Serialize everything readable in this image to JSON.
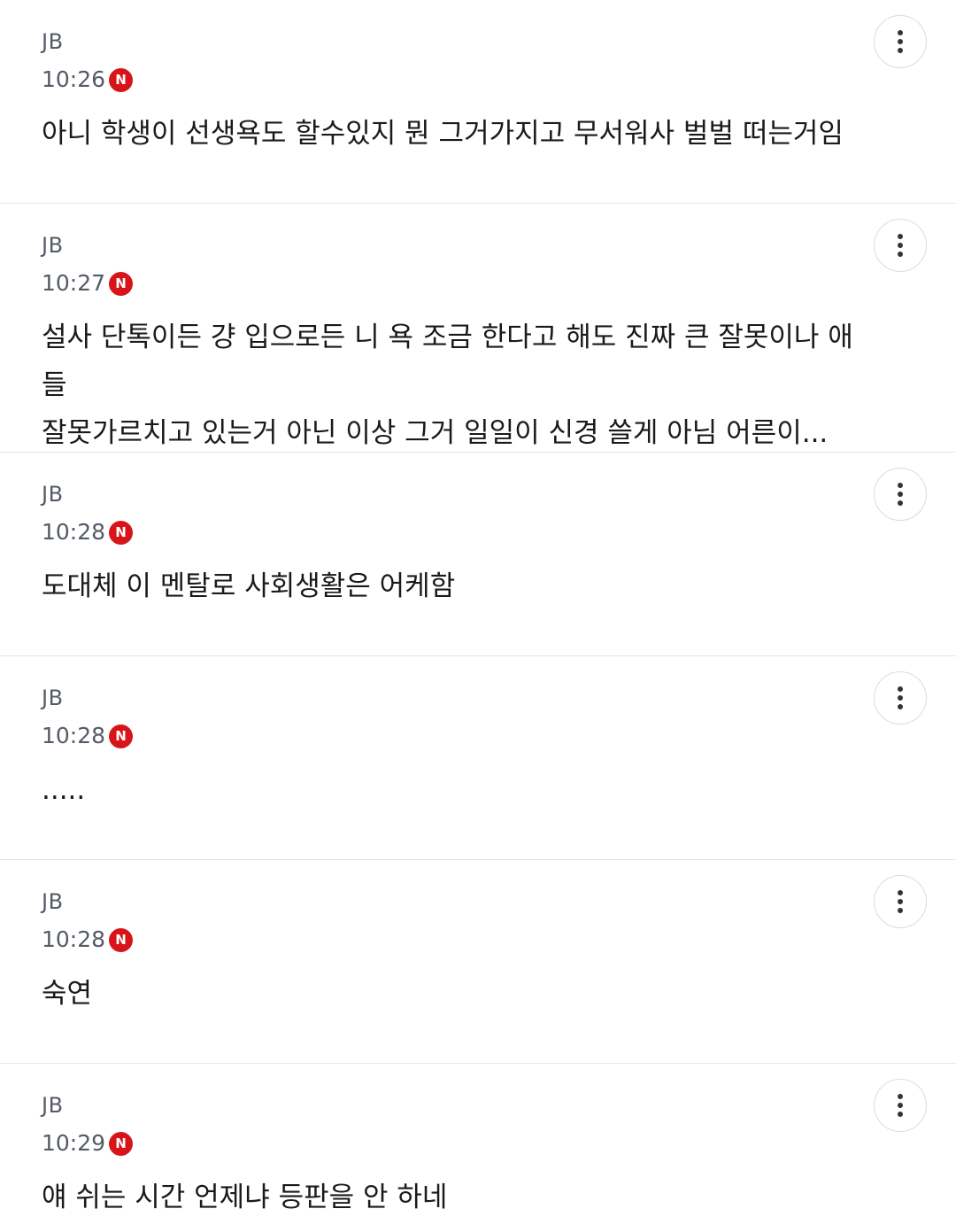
{
  "comments": [
    {
      "author": "JB",
      "time": "10:26",
      "badge": "N",
      "text": "아니 학생이 선생욕도 할수있지 뭔 그거가지고 무서워사 벌벌 떠는거임"
    },
    {
      "author": "JB",
      "time": "10:27",
      "badge": "N",
      "text": "설사 단톡이든 걍 입으로든 니 욕 조금 한다고 해도 진짜 큰 잘못이나 애들\n잘못가르치고 있는거 아닌 이상 그거 일일이 신경 쓸게 아님 어른이..."
    },
    {
      "author": "JB",
      "time": "10:28",
      "badge": "N",
      "text": "도대체 이 멘탈로 사회생활은 어케함"
    },
    {
      "author": "JB",
      "time": "10:28",
      "badge": "N",
      "text": "....."
    },
    {
      "author": "JB",
      "time": "10:28",
      "badge": "N",
      "text": "숙연"
    },
    {
      "author": "JB",
      "time": "10:29",
      "badge": "N",
      "text": "얘 쉬는 시간 언제냐 등판을 안 하네"
    }
  ],
  "icons": {
    "more": "more-vertical-icon",
    "new": "new-badge-icon"
  },
  "colors": {
    "badge": "#d8141b",
    "meta_text": "#555b66",
    "divider": "#e6e6e6"
  }
}
